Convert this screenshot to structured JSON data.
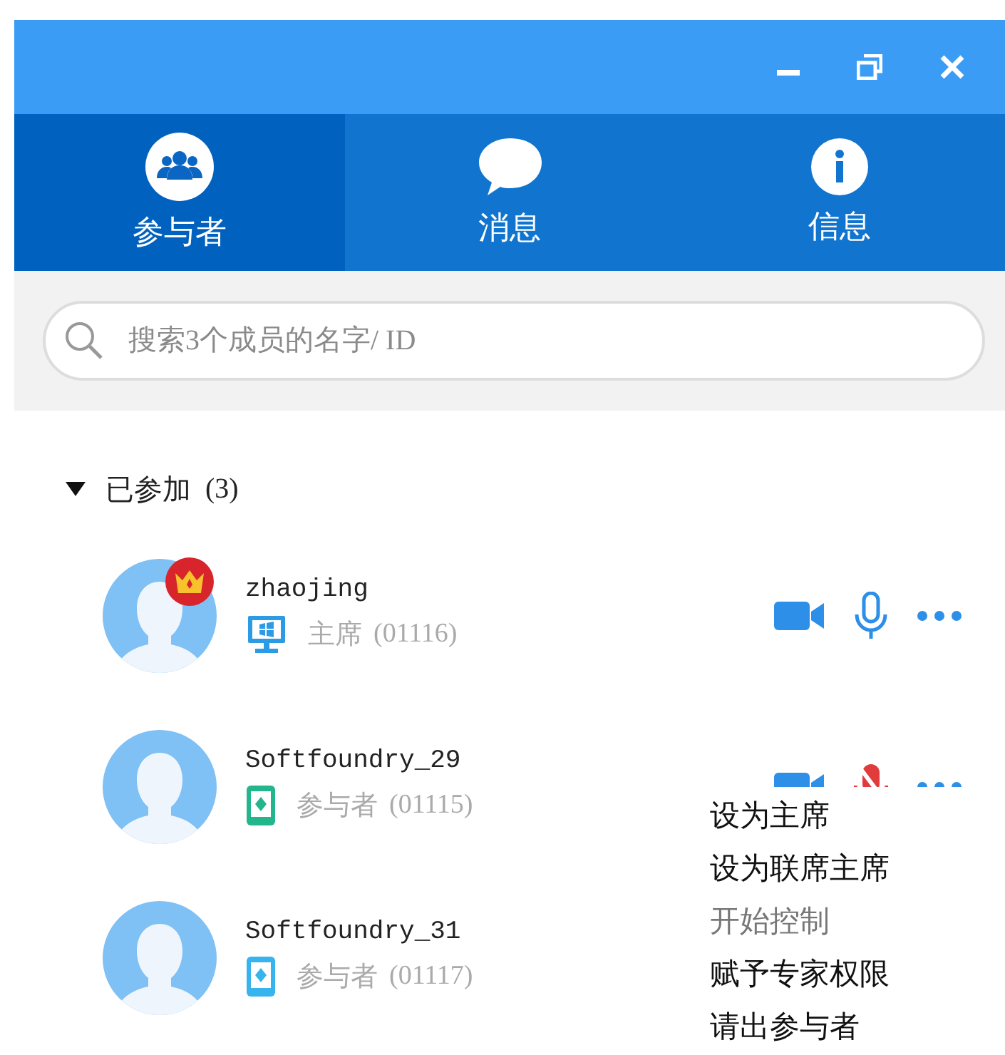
{
  "tabs": [
    {
      "label": "参与者",
      "kind": "people",
      "selected": true
    },
    {
      "label": "消息",
      "kind": "chat",
      "selected": false
    },
    {
      "label": "信息",
      "kind": "info",
      "selected": false
    }
  ],
  "search": {
    "placeholder": "搜索3个成员的名字/ ID"
  },
  "group": {
    "label": "已参加",
    "count": "(3)",
    "expanded": true
  },
  "participants": [
    {
      "name": "zhaojing",
      "role": "主席",
      "id": "(01116)",
      "host": true,
      "kind": "desktop",
      "color": "#2c9be6",
      "mic_muted": false
    },
    {
      "name": "Softfoundry_29",
      "role": "参与者",
      "id": "(01115)",
      "host": false,
      "kind": "mobile",
      "color": "#23b58c",
      "mic_muted": true
    },
    {
      "name": "Softfoundry_31",
      "role": "参与者",
      "id": "(01117)",
      "host": false,
      "kind": "mobile",
      "color": "#37b4ee"
    }
  ],
  "menu": [
    {
      "label": "设为主席",
      "disabled": false
    },
    {
      "label": "设为联席主席",
      "disabled": false
    },
    {
      "label": "开始控制",
      "disabled": true
    },
    {
      "label": "赋予专家权限",
      "disabled": false
    },
    {
      "label": "请出参与者",
      "disabled": false
    }
  ]
}
